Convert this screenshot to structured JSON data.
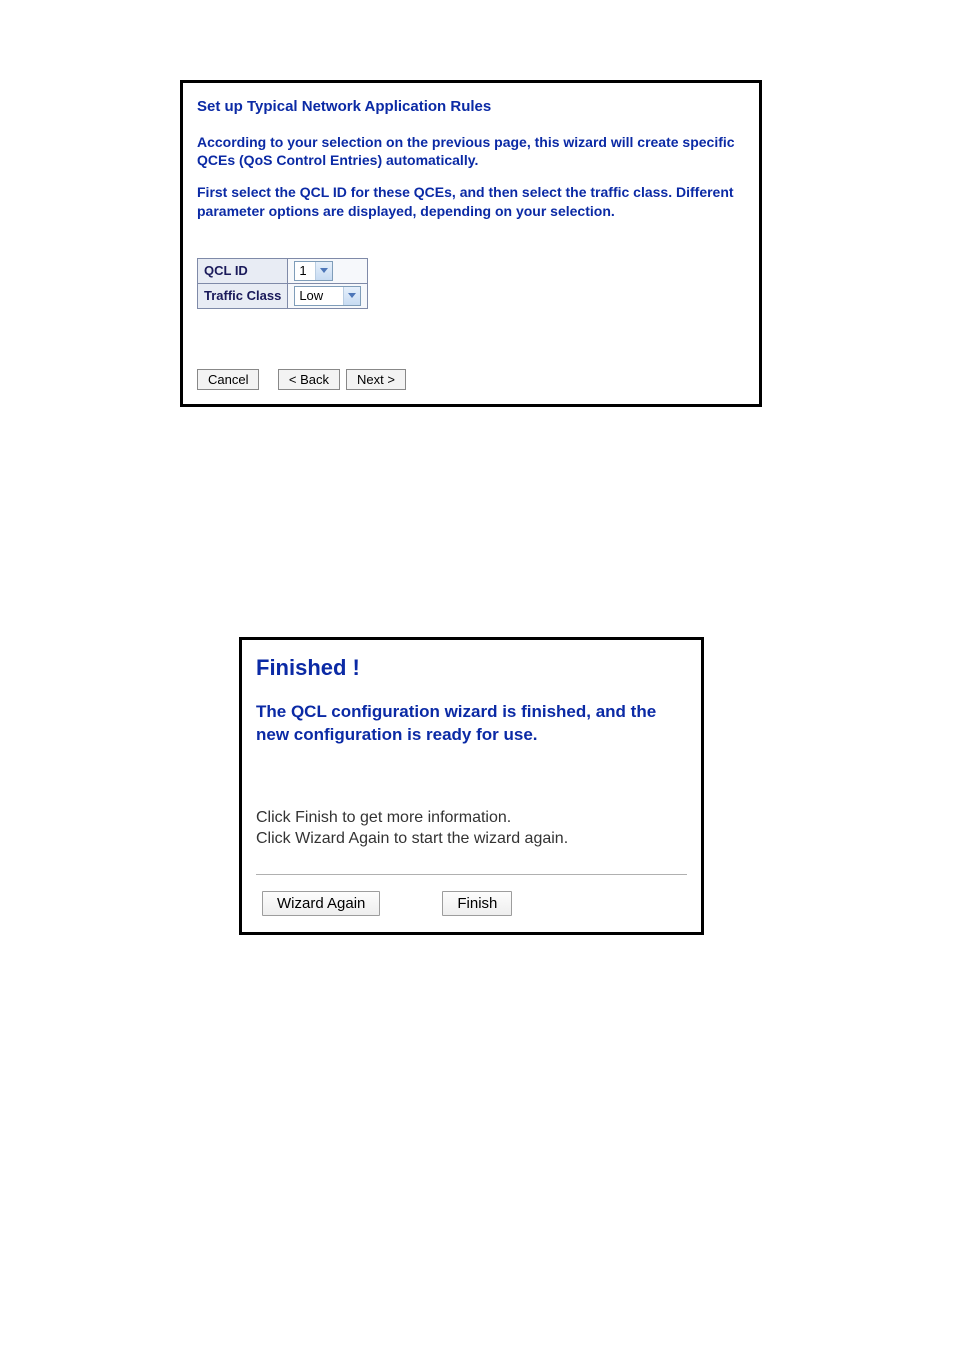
{
  "panel1": {
    "title": "Set up Typical Network Application Rules",
    "paragraph1": "According to your selection on the previous page, this wizard will create specific QCEs (QoS Control Entries) automatically.",
    "paragraph2": "First select the QCL ID for these QCEs, and then select the traffic class. Different parameter options are displayed, depending on your selection.",
    "form": {
      "qcl_id_label": "QCL ID",
      "qcl_id_value": "1",
      "traffic_class_label": "Traffic Class",
      "traffic_class_value": "Low"
    },
    "buttons": {
      "cancel": "Cancel",
      "back": "< Back",
      "next": "Next >"
    }
  },
  "panel2": {
    "title": "Finished !",
    "subtitle": "The QCL configuration wizard is finished, and the new configuration is ready for use.",
    "instruction1": "Click Finish to get more information.",
    "instruction2": "Click Wizard Again to start the wizard again.",
    "buttons": {
      "wizard_again": "Wizard Again",
      "finish": "Finish"
    }
  }
}
